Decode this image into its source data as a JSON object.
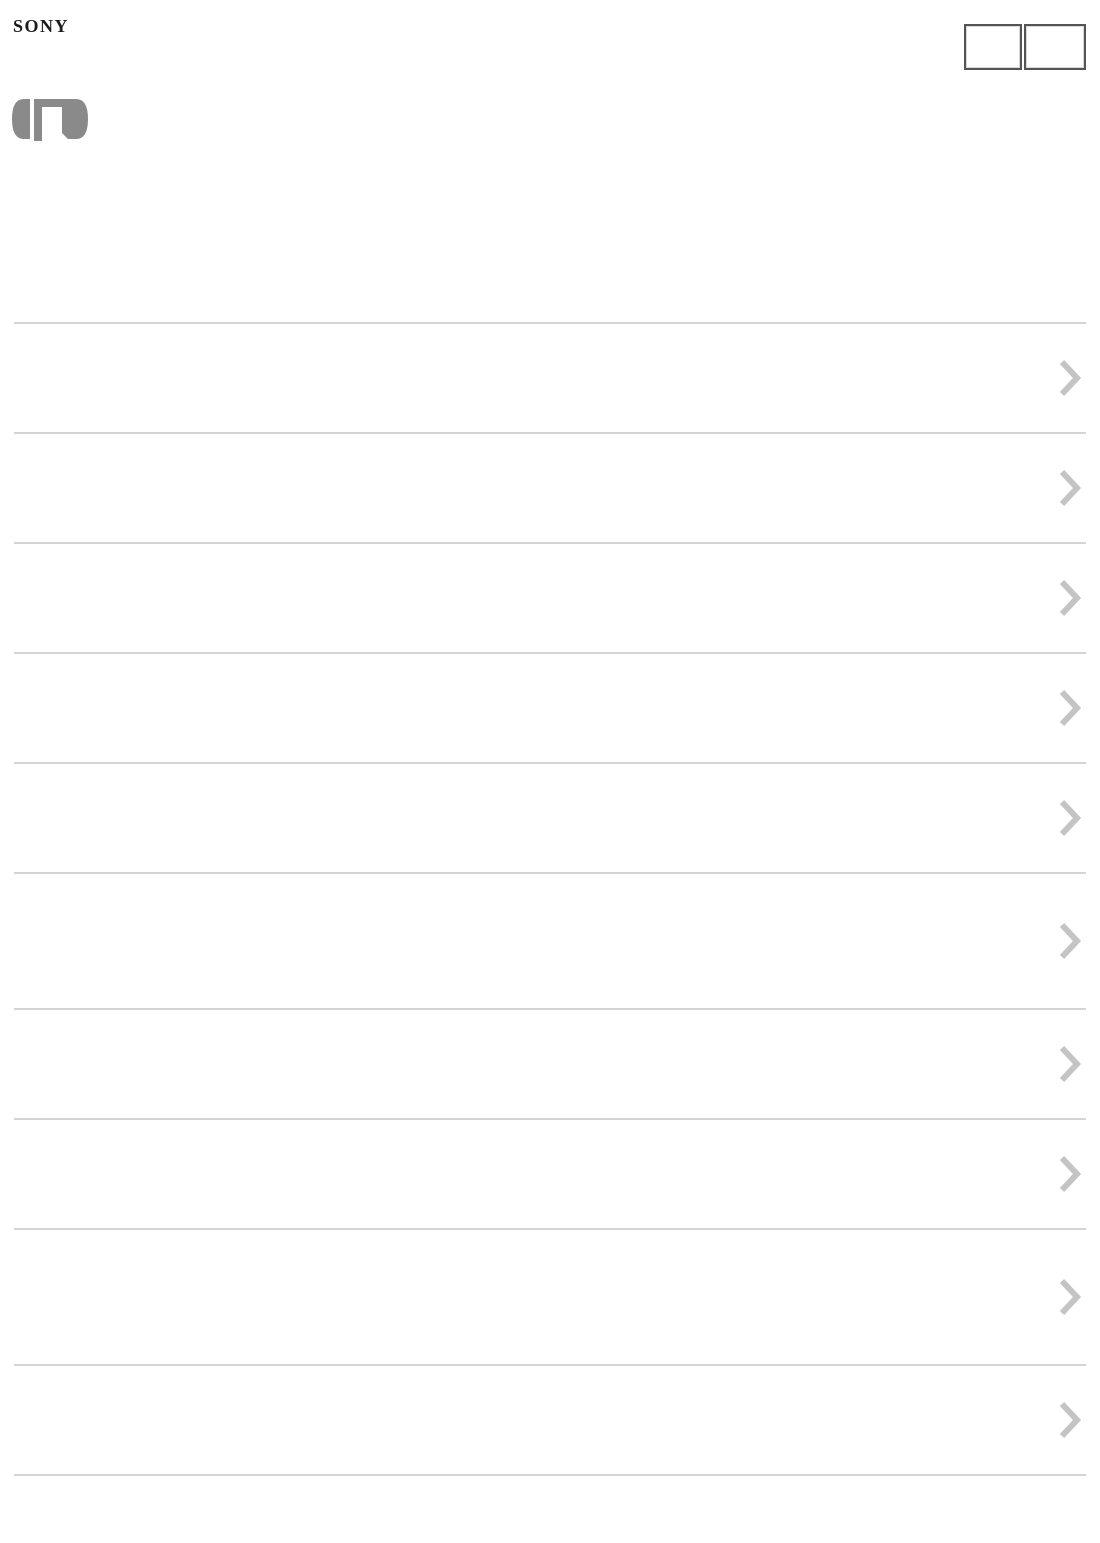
{
  "header": {
    "brand": "SONY",
    "buttons": [
      {
        "name": "header-button-1",
        "label": ""
      },
      {
        "name": "header-button-2",
        "label": ""
      }
    ]
  },
  "category": {
    "icon": "camera-bracket-icon",
    "icon_color": "#8a8a8a"
  },
  "list": {
    "border_color": "#d4d4d4",
    "chevron_color": "#c4c4c4",
    "items": [
      {
        "label": "",
        "icon": "chevron-right-icon"
      },
      {
        "label": "",
        "icon": "chevron-right-icon"
      },
      {
        "label": "",
        "icon": "chevron-right-icon"
      },
      {
        "label": "",
        "icon": "chevron-right-icon"
      },
      {
        "label": "",
        "icon": "chevron-right-icon"
      },
      {
        "label": "",
        "icon": "chevron-right-icon"
      },
      {
        "label": "",
        "icon": "chevron-right-icon"
      },
      {
        "label": "",
        "icon": "chevron-right-icon"
      },
      {
        "label": "",
        "icon": "chevron-right-icon"
      },
      {
        "label": "",
        "icon": "chevron-right-icon"
      }
    ]
  }
}
